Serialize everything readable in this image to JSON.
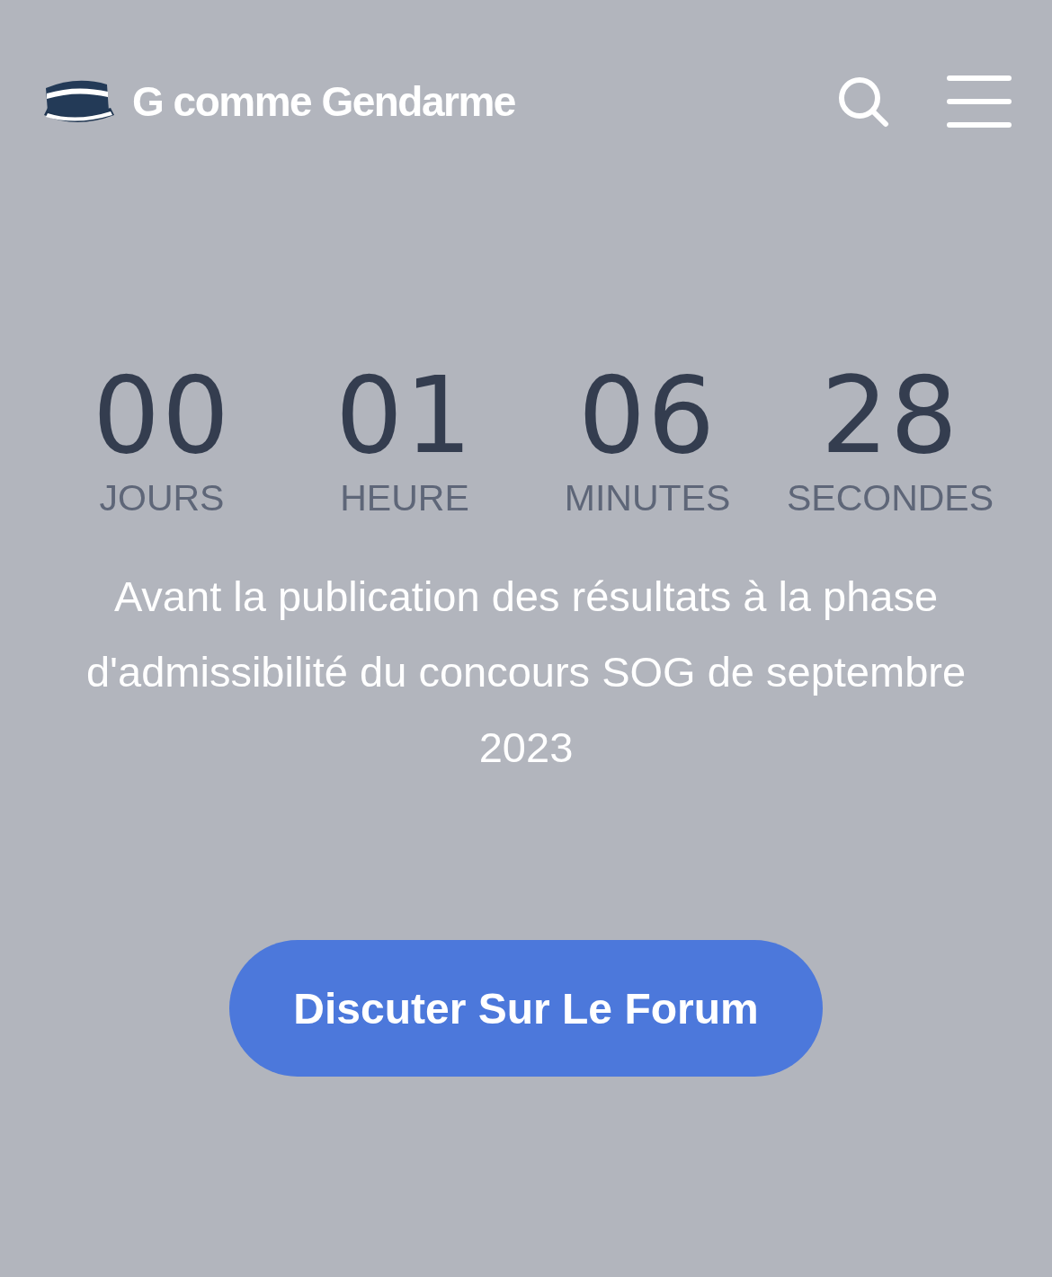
{
  "header": {
    "title": "G comme Gendarme"
  },
  "countdown": [
    {
      "value": "00",
      "label": "JOURS"
    },
    {
      "value": "01",
      "label": "HEURE"
    },
    {
      "value": "06",
      "label": "MINUTES"
    },
    {
      "value": "28",
      "label": "SECONDES"
    }
  ],
  "message": "Avant la publication des résultats à la phase d'admissibilité du concours SOG de septembre 2023",
  "button": {
    "label": "Discuter Sur Le Forum"
  }
}
